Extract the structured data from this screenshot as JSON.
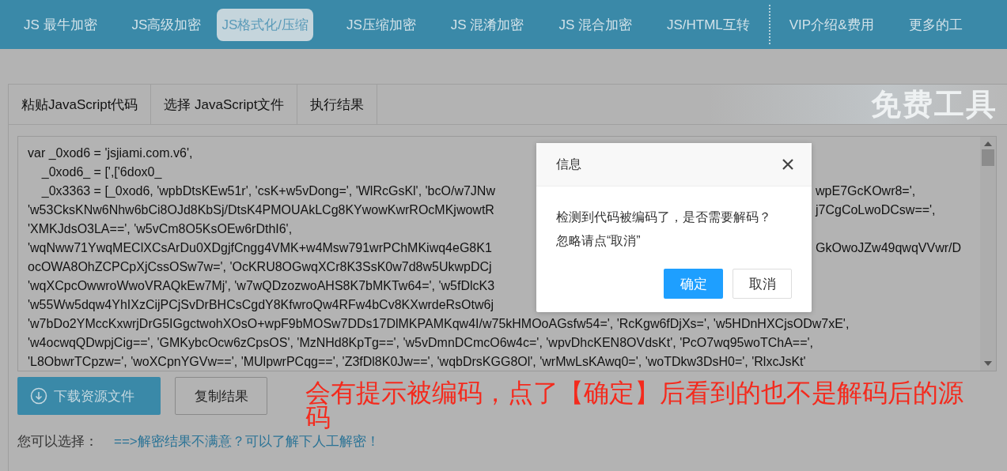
{
  "nav": {
    "items": [
      {
        "label": "JS 最牛加密",
        "selected": false,
        "divider_before": false
      },
      {
        "label": "JS高级加密",
        "selected": false,
        "divider_before": false
      },
      {
        "label": "JS格式化/压缩",
        "selected": true,
        "divider_before": false
      },
      {
        "label": "JS压缩加密",
        "selected": false,
        "divider_before": false
      },
      {
        "label": "JS 混淆加密",
        "selected": false,
        "divider_before": false
      },
      {
        "label": "JS 混合加密",
        "selected": false,
        "divider_before": false
      },
      {
        "label": "JS/HTML互转",
        "selected": false,
        "divider_before": false
      },
      {
        "label": "VIP介绍&费用",
        "selected": false,
        "divider_before": true
      },
      {
        "label": "更多的工",
        "selected": false,
        "divider_before": false
      }
    ]
  },
  "panel": {
    "tabs": [
      "粘贴JavaScript代码",
      "选择 JavaScript文件",
      "执行结果"
    ],
    "banner": "免费工具",
    "code_lines": [
      {
        "left": "var _0xod6 = 'jsjiami.com.v6',"
      },
      {
        "left": "    _0xod6_ = [',['6dox0_"
      },
      {
        "left": "    _0x3363 = [_0xod6, 'wpbDtsKEw51r', 'csK+w5vDong=', 'WlRcGsKl', 'bcO/w7JNw",
        "right": "wpE7GcKOwr8=',"
      },
      {
        "left": "'w53CksKNw6Nhw6bCi8OJd8KbSj/DtsK4PMOUAkLCg8KYwowKwrROcMKjwowtR",
        "right": "j7CgCoLwoDCsw==',"
      },
      {
        "left": "'XMKJdsO3LA==', 'w5vCm8O5KsOEw6rDthI6',"
      },
      {
        "left": "'wqNww71YwqMEClXCsArDu0XDgjfCngg4VMK+w4Msw791wrPChMKiwq4eG8K1",
        "right": "GkOwoJZw49qwqVVwr/D"
      },
      {
        "left": "ocOWA8OhZCPCpXjCssOSw7w=', 'OcKRU8OGwqXCr8K3SsK0w7d8w5UkwpDCj"
      },
      {
        "left": "'wqXCpcOwwroWwoVRAQkEw7Mj', 'w7wQDzozwoAHS8K7bMKTw64=', 'w5fDlcK3"
      },
      {
        "left": "'w55Ww5dqw4YhIXzCijPCjSvDrBHCsCgdY8KfwroQw4RFw4bCv8KXwrdeRsOtw6j"
      },
      {
        "left": "'w7bDo2YMccKxwrjDrG5IGgctwohXOsO+wpF9bMOSw7DDs17DlMKPAMKqw4I/w75kHMOoAGsfw54=', 'RcKgw6fDjXs=', 'w5HDnHXCjsODw7xE',"
      },
      {
        "left": "'w4ocwqQDwpjCig==', 'GMKybcOcw6zCpsOS', 'MzNHd8KpTg==', 'w5vDmnDCmcO6w4c=', 'wpvDhcKEN8OVdsKt', 'PcO7wq95woTChA==',"
      },
      {
        "left": "'L8ObwrTCpzw=', 'woXCpnYGVw==', 'MUlpwrPCqg==', 'Z3fDl8K0Jw==', 'wqbDrsKGG8Ol', 'wrMwLsKAwq0=', 'woTDkw3DsH0=', 'RlxcJsKt'"
      }
    ],
    "buttons": [
      {
        "kind": "primary",
        "label": "下载资源文件"
      },
      {
        "kind": "default",
        "label": "复制结果"
      }
    ],
    "hint_label": "您可以选择：",
    "hint_link": "==>解密结果不满意？可以了解下人工解密！"
  },
  "dialog": {
    "title": "信息",
    "message_lines": [
      "检测到代码被编码了，是否需要解码？",
      "忽略请点“取消”"
    ],
    "buttons": [
      {
        "kind": "primary",
        "label": "确定"
      },
      {
        "kind": "default",
        "label": "取消"
      }
    ]
  },
  "annotation": "会有提示被编码，点了【确定】后看到的也不是解码后的源码"
}
